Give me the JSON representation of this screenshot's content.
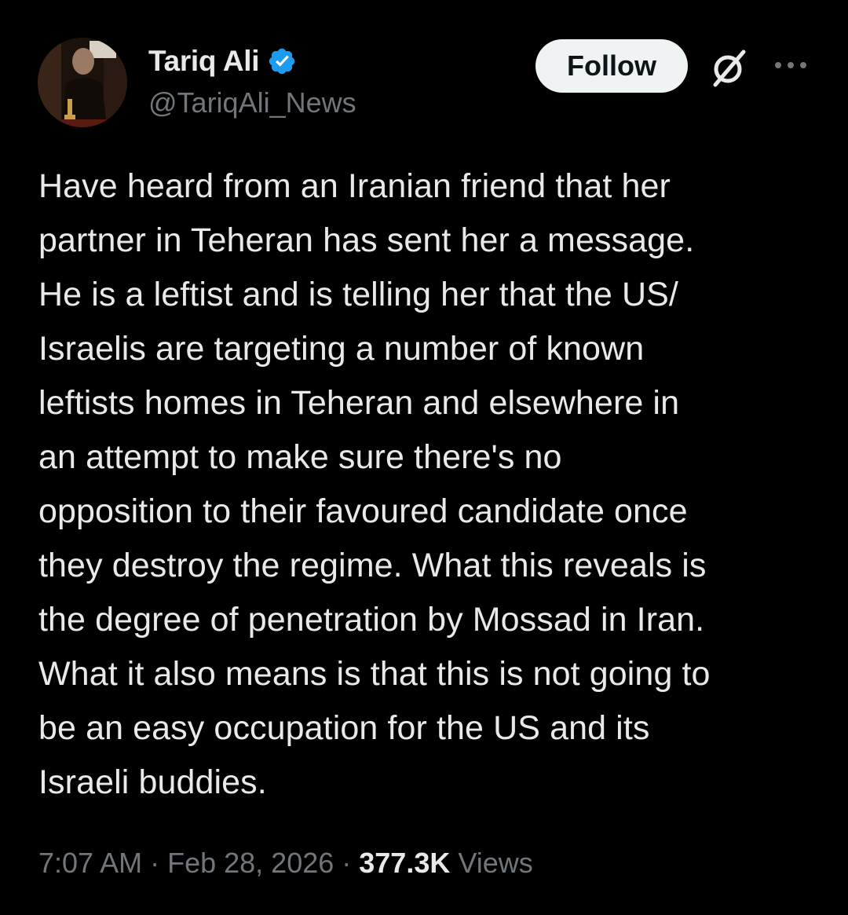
{
  "author": {
    "display_name": "Tariq Ali",
    "handle": "@TariqAli_News",
    "verified_color": "#1d9bf0"
  },
  "actions": {
    "follow_label": "Follow",
    "grok_icon": "grok-icon",
    "more_icon": "more-icon"
  },
  "tweet": {
    "text": "Have heard from an Iranian friend that her\npartner in Teheran has sent her a message.\nHe is a leftist and is telling her that the US/\nIsraelis are targeting a number of known\nleftists homes in Teheran and elsewhere in\nan attempt to make sure there's no\nopposition to their favoured candidate once\nthey destroy the regime. What this reveals is\nthe degree of penetration by Mossad in Iran.\nWhat it also means is that this is not going to\nbe an easy occupation for the US and its\nIsraeli buddies."
  },
  "meta": {
    "time": "7:07 AM",
    "separator": "·",
    "date": "Feb 28, 2026",
    "views_count": "377.3K",
    "views_label": "Views"
  },
  "colors": {
    "background": "#000000",
    "text_primary": "#e7e9ea",
    "text_secondary": "#71767b",
    "button_bg": "#eff3f4"
  }
}
